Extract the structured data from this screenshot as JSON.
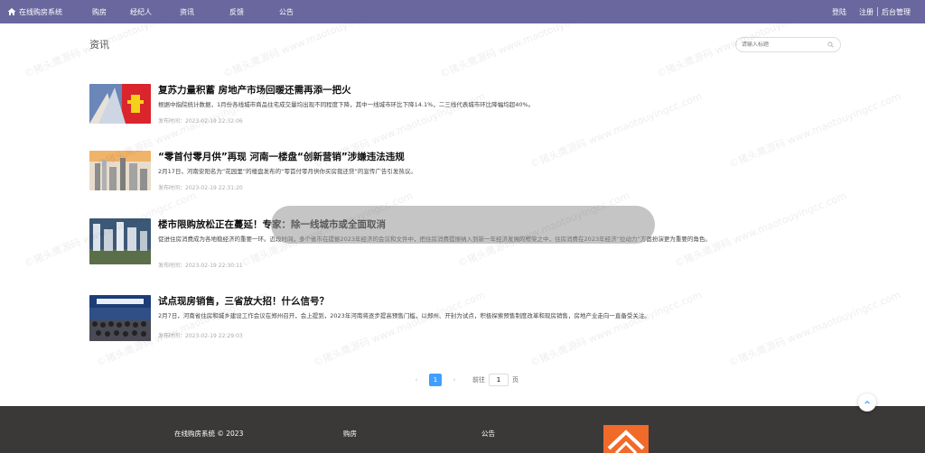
{
  "nav": {
    "brand": "在线购房系统",
    "items": [
      "购房",
      "经纪人",
      "资讯",
      "反馈",
      "公告"
    ],
    "login": "登陆",
    "register": "注册",
    "admin": "后台管理"
  },
  "page": {
    "title": "资讯",
    "search_placeholder": "请输入标题"
  },
  "news": [
    {
      "title": "复苏力量积蓄 房地产市场回暖还需再添一把火",
      "summary": "根据中指院统计数据，1月份各线城市商品住宅成交量均出现不同程度下降，其中一线城市环比下降14.1%，二三线代表城市环比降幅均超40%。",
      "time": "发布时间：2023-02-19 22:32:06"
    },
    {
      "title": "“零首付零月供”再现 河南一楼盘“创新营销”涉嫌违法违规",
      "summary": "2月17日，河南安阳名为“花园里”的楼盘发布的“零首付零月供你买房我还贷”的宣传广告引发热议。",
      "time": "发布时间：2023-02-19 22:31:20"
    },
    {
      "title": "楼市限购放松正在蔓延！专家：除一线城市或全面取消",
      "summary": "促进住房消费成为各地稳经济的重要一环。近段时间，多个省市在提振2023年经济的会议和文件中，把住房消费提振纳入到新一年经济发展的框架之中，住房消费在2023年经济“拉动力”方面扮演更为重要的角色。",
      "time": "发布时间：2023-02-19 22:30:11"
    },
    {
      "title": "试点现房销售，三省放大招！什么信号？",
      "summary": "2月7日，河南省住房和城乡建设工作会议在郑州召开，会上提到，2023年河南将逐步提高预售门槛，以郑州、开封为试点，积极探索预售制度改革和现房销售，房地产业走向一直备受关注。",
      "time": "发布时间：2023-02-19 22:29:03"
    }
  ],
  "pager": {
    "current": "1",
    "goto_label": "前往",
    "goto_value": "1",
    "page_unit": "页"
  },
  "footer": {
    "copyright": "在线购房系统 © 2023",
    "link1": "购房",
    "link2": "公告"
  },
  "watermark": {
    "text1": "©猪头鹰源码",
    "text2": "www.maotouyingcc.com"
  },
  "colors": {
    "nav_bg": "#6a679e",
    "footer_bg": "#3b3838",
    "pager_active": "#409eff",
    "logo": "#f06a2a"
  }
}
